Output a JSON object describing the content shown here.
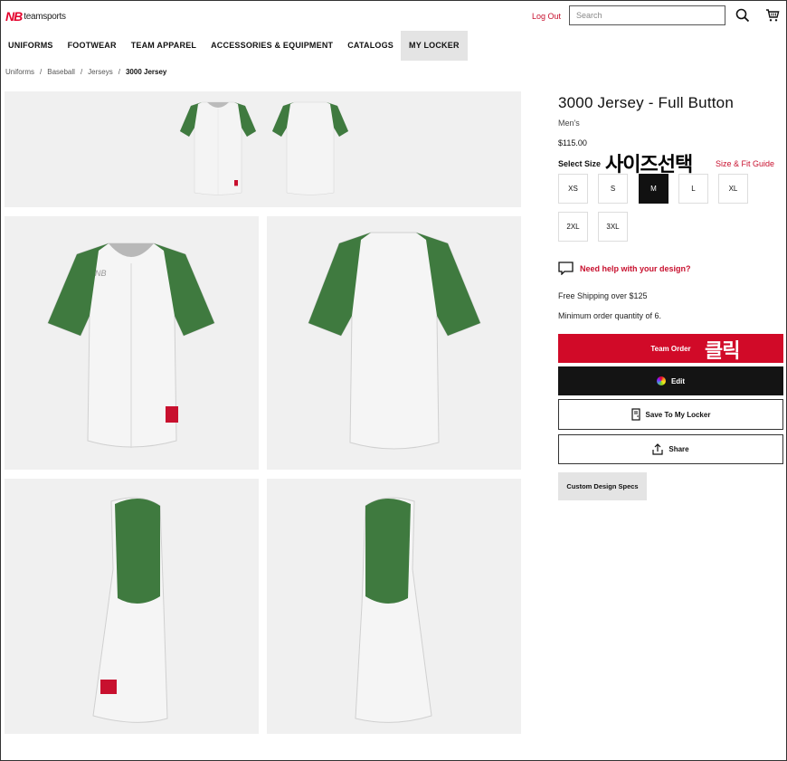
{
  "header": {
    "logo_text": "teamsports",
    "logout_label": "Log Out",
    "search_placeholder": "Search"
  },
  "nav": {
    "items": [
      "UNIFORMS",
      "FOOTWEAR",
      "TEAM APPAREL",
      "ACCESSORIES & EQUIPMENT",
      "CATALOGS",
      "MY LOCKER"
    ],
    "active": "MY LOCKER"
  },
  "breadcrumb": {
    "items": [
      "Uniforms",
      "Baseball",
      "Jerseys",
      "3000 Jersey"
    ],
    "separator": "/"
  },
  "product": {
    "title": "3000 Jersey - Full Button",
    "category": "Men's",
    "price": "$115.00",
    "select_size_label": "Select Size",
    "size_guide_label": "Size & Fit Guide",
    "sizes": [
      "XS",
      "S",
      "M",
      "L",
      "XL",
      "2XL",
      "3XL"
    ],
    "selected_size": "M",
    "help_label": "Need help with your design?",
    "shipping_text": "Free Shipping over $125",
    "min_order_text": "Minimum order quantity of 6.",
    "team_order_label": "Team Order",
    "edit_label": "Edit",
    "save_label": "Save To My Locker",
    "share_label": "Share",
    "specs_label": "Custom Design Specs"
  },
  "annotations": {
    "select_size_note": "사이즈선택",
    "click_note": "클릭"
  },
  "colors": {
    "brand_red": "#d10a28",
    "sleeve_green": "#3f7a3f",
    "jersey_white": "#f4f4f4",
    "image_bg": "#f0f0f0"
  }
}
